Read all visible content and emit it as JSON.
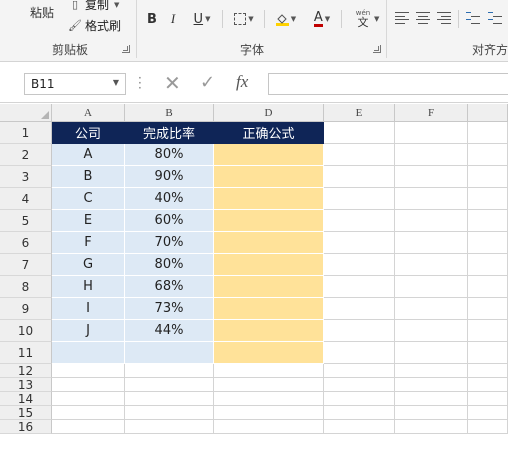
{
  "ribbon": {
    "clipboard": {
      "paste_label": "粘贴",
      "copy_label": "复制",
      "format_painter_label": "格式刷",
      "group_label": "剪贴板"
    },
    "font": {
      "bold_label": "B",
      "italic_label": "I",
      "underline_label": "U",
      "font_color_label": "A",
      "phonetic_label": "wén",
      "phonetic_sub": "文",
      "group_label": "字体"
    },
    "alignment": {
      "group_label": "对齐方"
    }
  },
  "formula_bar": {
    "name_box_value": "B11",
    "cancel_icon": "close-icon",
    "enter_icon": "check-icon",
    "fx_label": "fx",
    "formula_value": ""
  },
  "sheet": {
    "columns": [
      "A",
      "B",
      "D",
      "E",
      "F"
    ],
    "rows": [
      "1",
      "2",
      "3",
      "4",
      "5",
      "6",
      "7",
      "8",
      "9",
      "10",
      "11",
      "12",
      "13",
      "14",
      "15",
      "16"
    ],
    "header_row": [
      "公司",
      "完成比率",
      "正确公式"
    ],
    "data_rows": [
      {
        "company": "A",
        "rate": "80%"
      },
      {
        "company": "B",
        "rate": "90%"
      },
      {
        "company": "C",
        "rate": "40%"
      },
      {
        "company": "E",
        "rate": "60%"
      },
      {
        "company": "F",
        "rate": "70%"
      },
      {
        "company": "G",
        "rate": "80%"
      },
      {
        "company": "H",
        "rate": "68%"
      },
      {
        "company": "I",
        "rate": "73%"
      },
      {
        "company": "J",
        "rate": "44%"
      }
    ]
  },
  "colors": {
    "header_fill": "#0f2557",
    "data_fill": "#dde9f5",
    "formula_fill": "#ffe299"
  }
}
